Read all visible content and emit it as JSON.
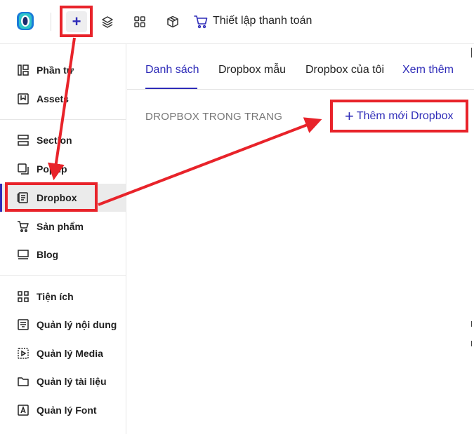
{
  "toolbar": {
    "add_symbol": "+",
    "checkout_label": "Thiết lập thanh toán",
    "icons": [
      "logo-icon",
      "plus-icon",
      "layers-icon",
      "grid-icon",
      "box-icon",
      "cart-icon"
    ]
  },
  "sidebar": {
    "items": [
      {
        "label": "Phần tử",
        "icon": "elements-icon"
      },
      {
        "label": "Assets",
        "icon": "assets-icon"
      },
      {
        "label": "Section",
        "icon": "section-icon"
      },
      {
        "label": "Popup",
        "icon": "popup-icon"
      },
      {
        "label": "Dropbox",
        "icon": "dropbox-icon"
      },
      {
        "label": "Sản phẩm",
        "icon": "cart-icon"
      },
      {
        "label": "Blog",
        "icon": "blog-icon"
      },
      {
        "label": "Tiện ích",
        "icon": "utilities-icon"
      },
      {
        "label": "Quản lý nội dung",
        "icon": "content-icon"
      },
      {
        "label": "Quản lý Media",
        "icon": "media-icon"
      },
      {
        "label": "Quản lý tài liệu",
        "icon": "folder-icon"
      },
      {
        "label": "Quản lý Font",
        "icon": "font-icon"
      }
    ],
    "active": "Dropbox"
  },
  "main": {
    "tabs": [
      {
        "label": "Danh sách",
        "active": true
      },
      {
        "label": "Dropbox mẫu",
        "active": false
      },
      {
        "label": "Dropbox của tôi",
        "active": false
      },
      {
        "label": "Xem thêm",
        "active": false
      }
    ],
    "section_title": "DROPBOX TRONG TRANG",
    "add_symbol": "+",
    "add_button_label": "Thêm mới Dropbox"
  },
  "colors": {
    "accent": "#2e2bb8",
    "annotation": "#e8232a",
    "active_bg": "#ebebeb"
  }
}
